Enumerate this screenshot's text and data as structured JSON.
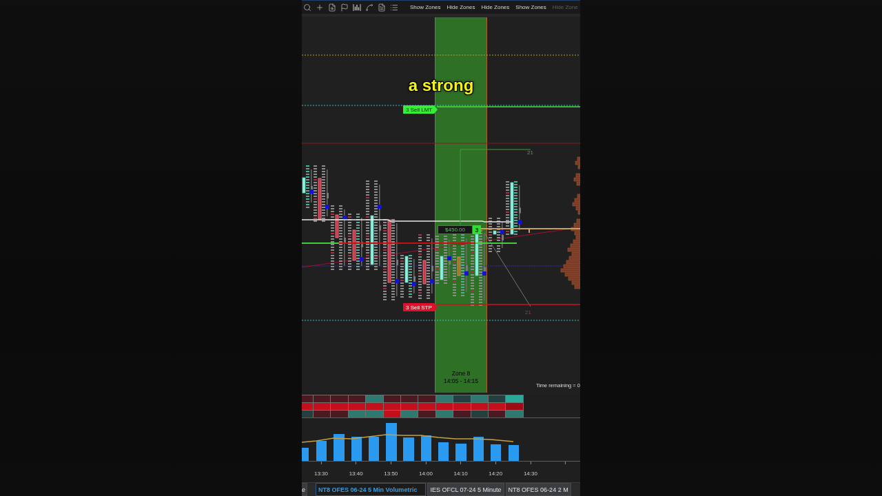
{
  "toolbar": {
    "buttons": [
      {
        "label": "Show Zones",
        "disabled": false
      },
      {
        "label": "Hide Zones",
        "disabled": false
      },
      {
        "label": "Hide Zones",
        "disabled": false
      },
      {
        "label": "Show Zones",
        "disabled": false
      },
      {
        "label": "Hide Zone",
        "disabled": true
      }
    ]
  },
  "chart": {
    "caption": "a strong",
    "orders": [
      {
        "kind": "limit",
        "label": "3 Sell LMT",
        "bracket_label": "21"
      },
      {
        "kind": "stop",
        "label": "3 Sell STP",
        "bracket_label": "21"
      }
    ],
    "position": {
      "profit": "$450.00",
      "quantity": "3"
    },
    "zone": {
      "title": "Zone 8",
      "time_range": "14:05 - 14:15"
    },
    "time_remaining": "Time remaining = 0"
  },
  "heatmap": {
    "rows": [
      {
        "cells": [
          {
            "color": "#4a1a20"
          },
          {
            "color": "#4a1a20"
          },
          {
            "color": "#4a1a20"
          },
          {
            "color": "#4a1a20"
          },
          {
            "color": "#2e7a70"
          },
          {
            "color": "#4a1a20"
          },
          {
            "color": "#4a1a20"
          },
          {
            "color": "#4a1a20"
          },
          {
            "color": "#2e7a70"
          },
          {
            "color": "#24403e"
          },
          {
            "color": "#2e7a70"
          },
          {
            "color": "#24403e"
          },
          {
            "color": "#2aa898"
          }
        ]
      },
      {
        "cells": [
          {
            "color": "#c4101c"
          },
          {
            "color": "#c4101c"
          },
          {
            "color": "#c4101c"
          },
          {
            "color": "#c4101c"
          },
          {
            "color": "#c4101c"
          },
          {
            "color": "#c4101c"
          },
          {
            "color": "#c4101c"
          },
          {
            "color": "#c4101c"
          },
          {
            "color": "#c4101c"
          },
          {
            "color": "#c4101c"
          },
          {
            "color": "#c4101c"
          },
          {
            "color": "#c4101c"
          },
          {
            "color": "#a00a16"
          }
        ]
      },
      {
        "cells": [
          {
            "color": "#24403e"
          },
          {
            "color": "#4a1a20"
          },
          {
            "color": "#4a1a20"
          },
          {
            "color": "#2e7a70"
          },
          {
            "color": "#2e7a70"
          },
          {
            "color": "#c4101c"
          },
          {
            "color": "#2e7a70"
          },
          {
            "color": "#4a1a20"
          },
          {
            "color": "#2e7a70"
          },
          {
            "color": "#4a1a20"
          },
          {
            "color": "#24403e"
          },
          {
            "color": "#4a1a20"
          },
          {
            "color": "#2e7a70"
          }
        ]
      }
    ]
  },
  "time_axis": {
    "labels": [
      "13:30",
      "13:40",
      "13:50",
      "14:00",
      "14:10",
      "14:20",
      "14:30"
    ]
  },
  "tabs": [
    {
      "label": "e",
      "selected": false
    },
    {
      "label": "NT8 OFES 06-24 5 Min Volumetric",
      "selected": true
    },
    {
      "label": "IES OFCL 07-24 5 Minute",
      "selected": false
    },
    {
      "label": "NT8 OFES 06-24 2 M",
      "selected": false
    }
  ]
}
